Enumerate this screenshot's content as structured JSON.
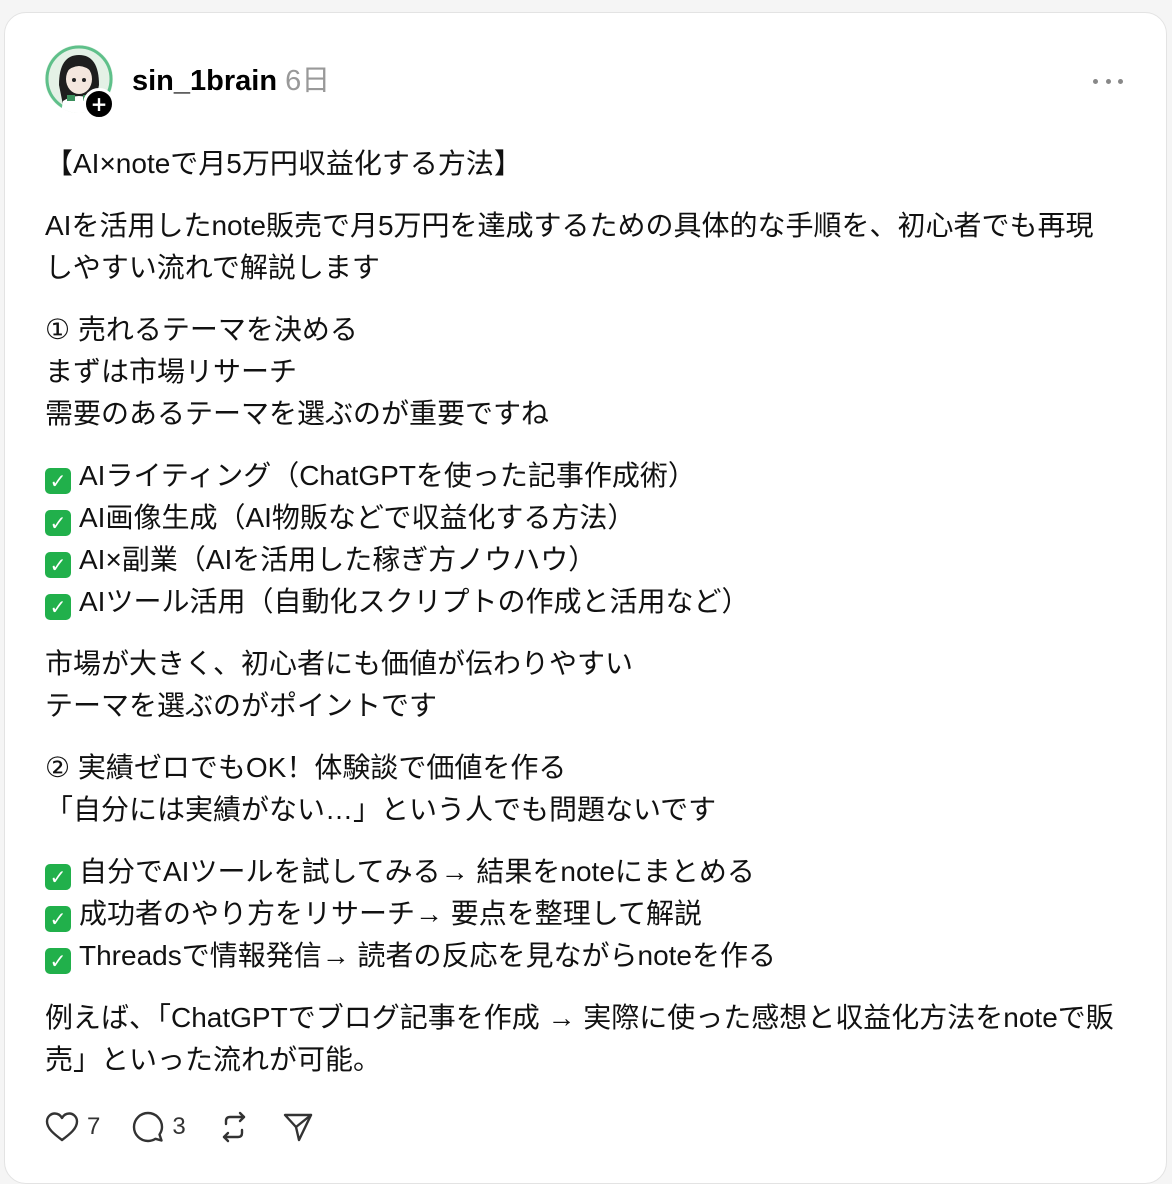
{
  "post": {
    "username": "sin_1brain",
    "timestamp": "6日",
    "follow_glyph": "+",
    "avatar_icon": "anime-character-avatar",
    "paragraphs": [
      {
        "kind": "text",
        "lines": [
          "【AI×noteで月5万円収益化する方法】"
        ]
      },
      {
        "kind": "text",
        "lines": [
          "AIを活用したnote販売で月5万円を達成するための具体的な手順を、初心者でも再現しやすい流れで解説します"
        ]
      },
      {
        "kind": "text",
        "lines": [
          "① 売れるテーマを決める",
          "まずは市場リサーチ",
          "需要のあるテーマを選ぶのが重要ですね"
        ]
      },
      {
        "kind": "check",
        "lines": [
          "AIライティング（ChatGPTを使った記事作成術）",
          "AI画像生成（AI物販などで収益化する方法）",
          "AI×副業（AIを活用した稼ぎ方ノウハウ）",
          "AIツール活用（自動化スクリプトの作成と活用など）"
        ]
      },
      {
        "kind": "text",
        "lines": [
          "市場が大きく、初心者にも価値が伝わりやすい",
          "テーマを選ぶのがポイントです"
        ]
      },
      {
        "kind": "text",
        "lines": [
          "② 実績ゼロでもOK！体験談で価値を作る",
          "「自分には実績がない…」という人でも問題ないです"
        ]
      },
      {
        "kind": "check",
        "lines": [
          "自分でAIツールを試してみる→ 結果をnoteにまとめる",
          "成功者のやり方をリサーチ→ 要点を整理して解説",
          "Threadsで情報発信→ 読者の反応を見ながらnoteを作る"
        ]
      },
      {
        "kind": "text",
        "lines": [
          "例えば、「ChatGPTでブログ記事を作成 → 実際に使った感想と収益化方法をnoteで販売」といった流れが可能。"
        ]
      }
    ],
    "check_glyph": "✓",
    "actions": {
      "like_count": "7",
      "reply_count": "3",
      "like_icon": "heart-icon",
      "reply_icon": "comment-icon",
      "repost_icon": "repost-icon",
      "share_icon": "send-icon"
    },
    "colors": {
      "check_green": "#21b04b",
      "timestamp_gray": "#999999"
    }
  }
}
